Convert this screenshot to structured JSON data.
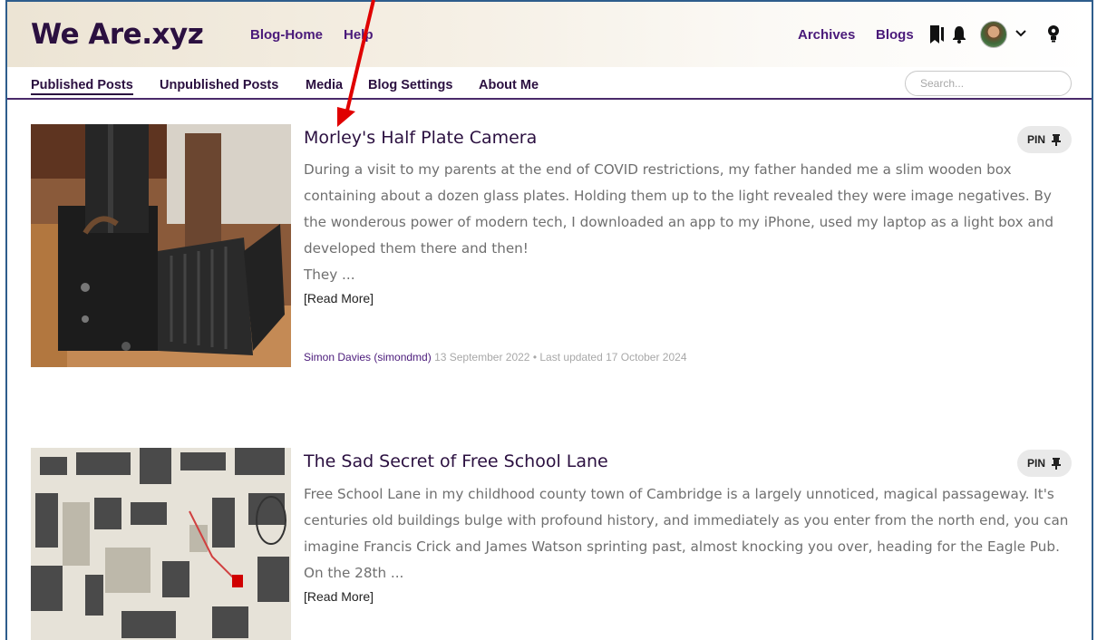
{
  "brand": {
    "logo": "We Are.xyz"
  },
  "topnav": {
    "blog_home": "Blog-Home",
    "help": "Help",
    "archives": "Archives",
    "blogs": "Blogs",
    "icons": [
      "bookmark-icon",
      "bell-icon",
      "avatar",
      "chevron-down-icon",
      "lightbulb-icon"
    ]
  },
  "tabs": [
    {
      "label": "Published Posts",
      "active": true
    },
    {
      "label": "Unpublished Posts",
      "active": false
    },
    {
      "label": "Media",
      "active": false
    },
    {
      "label": "Blog Settings",
      "active": false
    },
    {
      "label": "About Me",
      "active": false
    }
  ],
  "search": {
    "placeholder": "Search..."
  },
  "posts": [
    {
      "title": "Morley's Half Plate Camera",
      "excerpt": "During a visit to my parents at the end of COVID restrictions, my father handed me a slim wooden box containing about a dozen glass plates. Holding them up to the light revealed they were image negatives. By the wonderous power of modern tech, I downloaded an app to my iPhone, used my laptop as a light box and developed them there and then!",
      "excerpt_tail": "They ...",
      "read_more": "[Read More]",
      "author": "Simon Davies (simondmd)",
      "date": "13 September 2022",
      "separator": "•",
      "updated": "Last updated 17 October 2024",
      "pin": "PIN"
    },
    {
      "title": "The Sad Secret of Free School Lane",
      "excerpt": "Free School Lane in my childhood county town of Cambridge is a largely unnoticed, magical passageway. It's centuries old buildings bulge with profound history, and immediately as you enter from the north end, you can imagine Francis Crick and James Watson sprinting past, almost knocking you over, heading for the Eagle Pub. On the 28th ...",
      "read_more": "[Read More]",
      "pin": "PIN"
    }
  ],
  "colors": {
    "brand": "#2b1040",
    "link": "#4a1a7a",
    "annotation_arrow": "#e00000"
  }
}
